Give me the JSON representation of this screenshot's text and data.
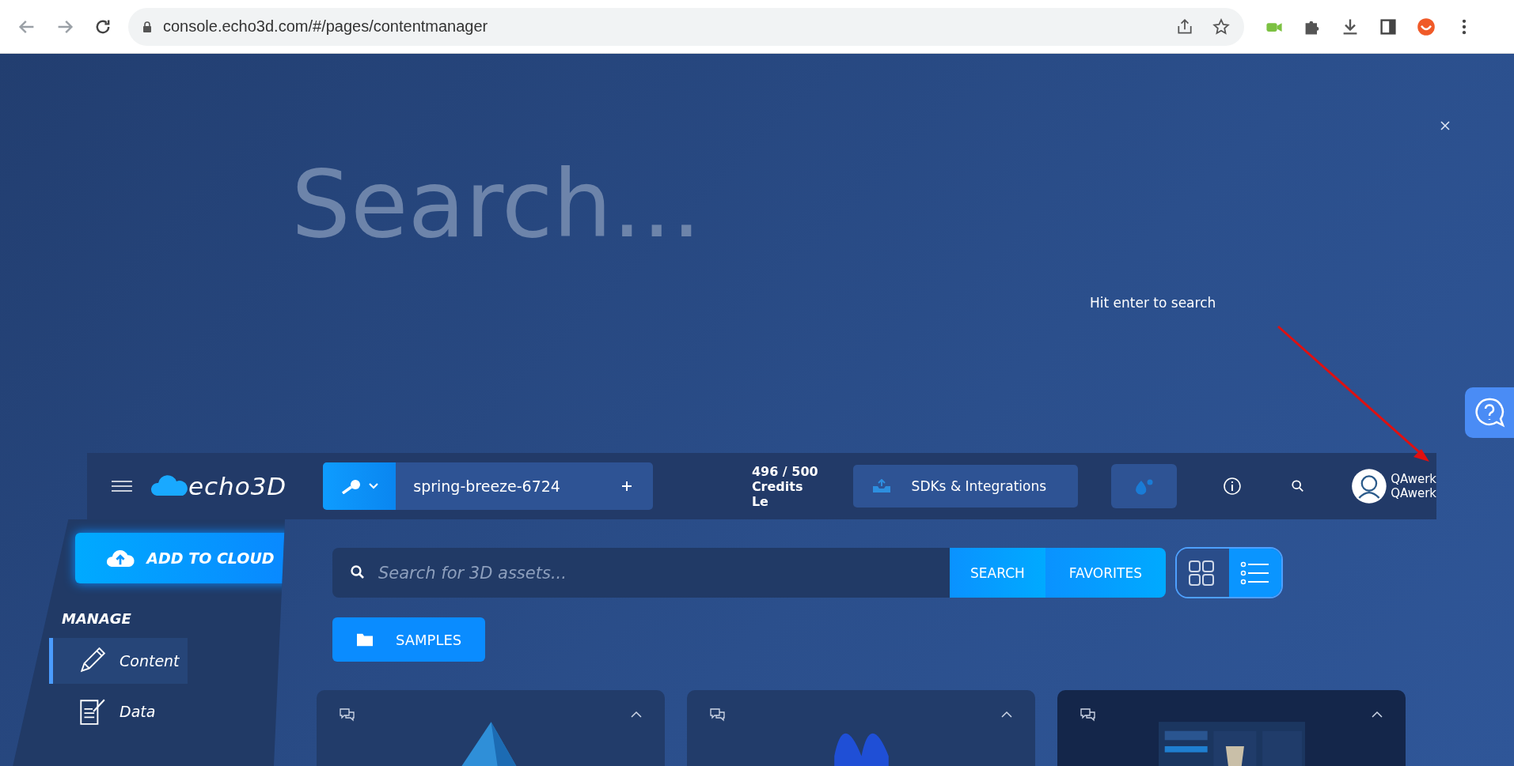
{
  "browser": {
    "url": "console.echo3d.com/#/pages/contentmanager"
  },
  "search_overlay": {
    "placeholder": "Search...",
    "hint": "Hit enter to search"
  },
  "header": {
    "logo": "echo3D",
    "project": "spring-breeze-6724",
    "credits": [
      "496 / 500",
      "Credits Le"
    ],
    "sdk_button": "SDKs & Integrations",
    "user": [
      "QAwerk",
      "QAwerk"
    ]
  },
  "sidebar": {
    "add_button": "ADD TO CLOUD",
    "section": "MANAGE",
    "items": [
      {
        "label": "Content",
        "kind": "pencil",
        "selected": true
      },
      {
        "label": "Data",
        "kind": "note",
        "selected": false
      }
    ]
  },
  "search": {
    "placeholder": "Search for 3D assets...",
    "buttons": [
      "SEARCH",
      "FAVORITES"
    ],
    "views": [
      {
        "kind": "grid",
        "selected": false
      },
      {
        "kind": "list",
        "selected": true
      }
    ]
  },
  "folders": [
    "SAMPLES"
  ],
  "cards": [
    {
      "kind": "gem"
    },
    {
      "kind": "figure"
    },
    {
      "kind": "screenshot"
    }
  ]
}
